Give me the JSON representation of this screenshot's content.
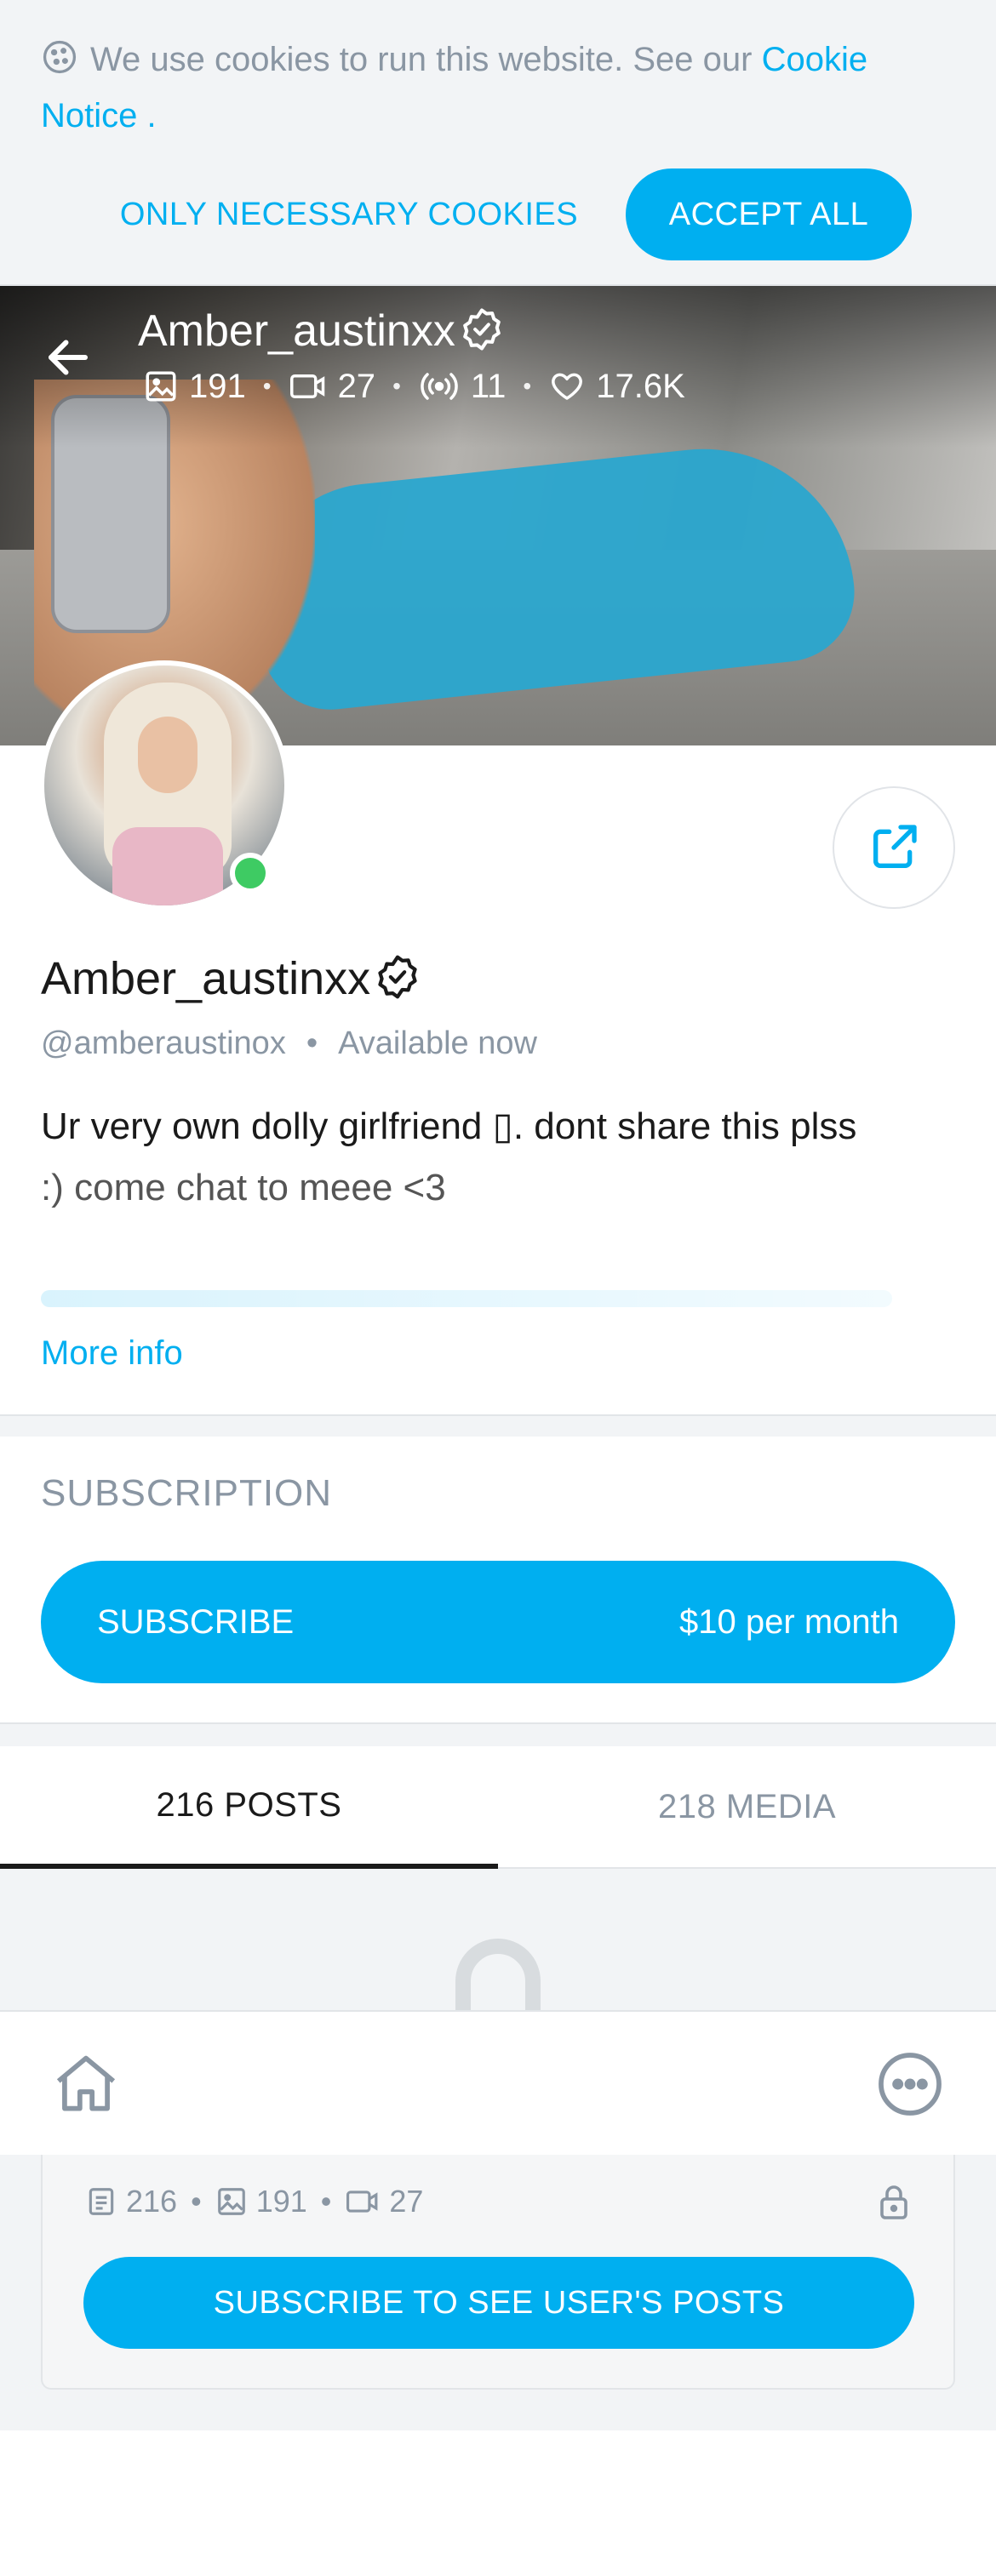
{
  "cookie": {
    "text": "We use cookies to run this website. See our",
    "link_text": "Cookie Notice",
    "suffix": " .",
    "necessary_label": "ONLY NECESSARY COOKIES",
    "accept_label": "ACCEPT ALL"
  },
  "cover": {
    "name": "Amber_austinxx",
    "stats": {
      "photos": "191",
      "videos": "27",
      "streams": "11",
      "likes": "17.6K"
    }
  },
  "profile": {
    "name": "Amber_austinxx",
    "handle": "@amberaustinox",
    "status": "Available now",
    "bio_line1": "Ur very own dolly girlfriend ▯. dont share this plss",
    "bio_line2": ":) come chat to meee <3",
    "more_info": "More info"
  },
  "subscription": {
    "title": "SUBSCRIPTION",
    "button_label": "SUBSCRIBE",
    "price": "$10 per month"
  },
  "tabs": [
    {
      "label": "216 POSTS"
    },
    {
      "label": "218 MEDIA"
    }
  ],
  "locked": {
    "posts": "216",
    "photos": "191",
    "videos": "27",
    "button_label": "SUBSCRIBE TO SEE USER'S POSTS"
  },
  "colors": {
    "accent": "#00aff0",
    "muted": "#8a96a3",
    "online": "#3ecb63"
  },
  "icons": [
    "cookie-icon",
    "back-arrow-icon",
    "verified-icon",
    "image-icon",
    "video-icon",
    "stream-icon",
    "heart-icon",
    "share-icon",
    "lock-icon",
    "home-icon",
    "more-icon",
    "posts-icon"
  ]
}
